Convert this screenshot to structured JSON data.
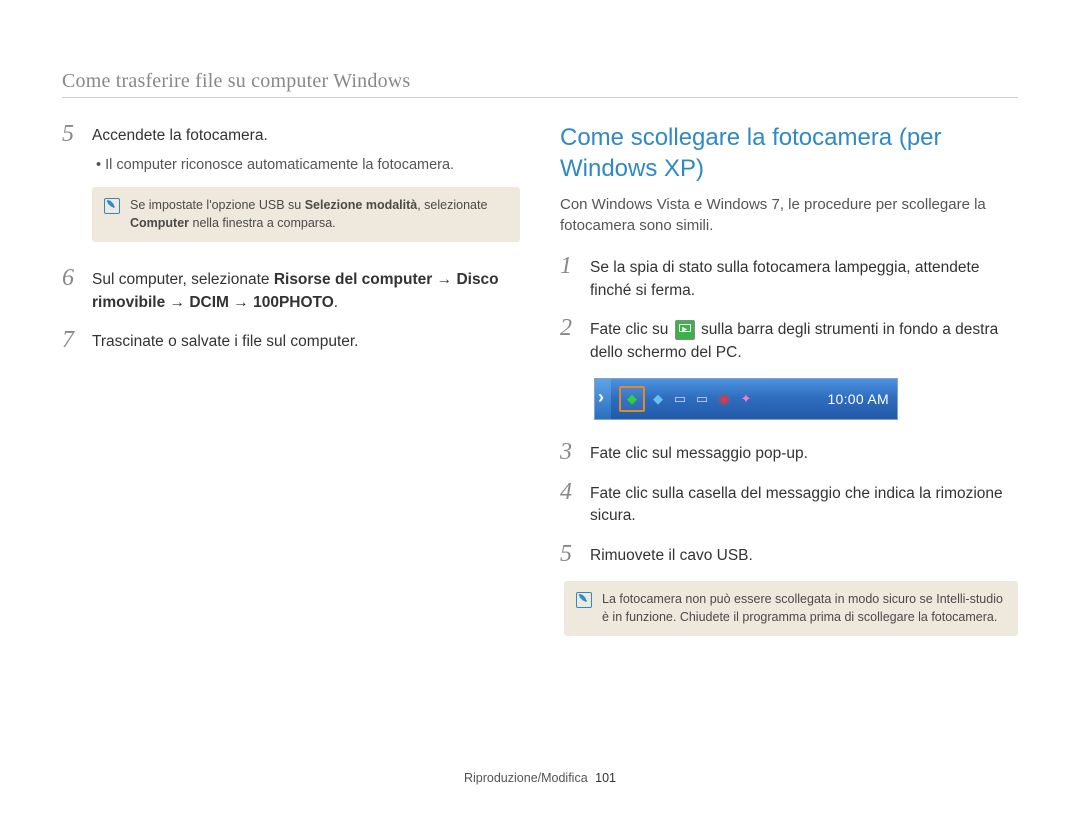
{
  "header": "Come trasferire file su computer Windows",
  "left": {
    "steps": [
      {
        "num": "5",
        "text_plain": "Accendete la fotocamera."
      },
      {
        "num": "6",
        "text_html": "Sul computer, selezionate <b>Risorse del computer</b> → <b>Disco rimovibile</b> → <b>DCIM</b> → <b>100PHOTO</b>."
      },
      {
        "num": "7",
        "text_plain": "Trascinate o salvate i file sul computer."
      }
    ],
    "sub_bullet": "Il computer riconosce automaticamente la fotocamera.",
    "note_html": "Se impostate l'opzione USB su <b>Selezione modalità</b>, selezionate <b>Computer</b> nella finestra a comparsa."
  },
  "right": {
    "title": "Come scollegare la fotocamera (per Windows XP)",
    "intro": "Con Windows Vista e Windows 7, le procedure per scollegare la fotocamera sono simili.",
    "steps": [
      {
        "num": "1",
        "text_plain": "Se la spia di stato sulla fotocamera lampeggia, attendete finché si ferma."
      },
      {
        "num": "2",
        "text_before": "Fate clic su ",
        "text_after": " sulla barra degli strumenti in fondo a destra dello schermo del PC."
      },
      {
        "num": "3",
        "text_plain": "Fate clic sul messaggio pop-up."
      },
      {
        "num": "4",
        "text_plain": "Fate clic sulla casella del messaggio che indica la rimozione sicura."
      },
      {
        "num": "5",
        "text_plain": "Rimuovete il cavo USB."
      }
    ],
    "note_plain": "La fotocamera non può essere scollegata in modo sicuro se Intelli-studio è in funzione. Chiudete il programma prima di scollegare la fotocamera.",
    "taskbar": {
      "clock": "10:00 AM",
      "highlighted_icon": "safely-remove-hardware-icon",
      "icons": [
        "shield-icon",
        "monitor-icon",
        "display-icon",
        "volume-icon",
        "update-icon"
      ]
    }
  },
  "footer": {
    "section": "Riproduzione/Modifica",
    "page": "101"
  }
}
